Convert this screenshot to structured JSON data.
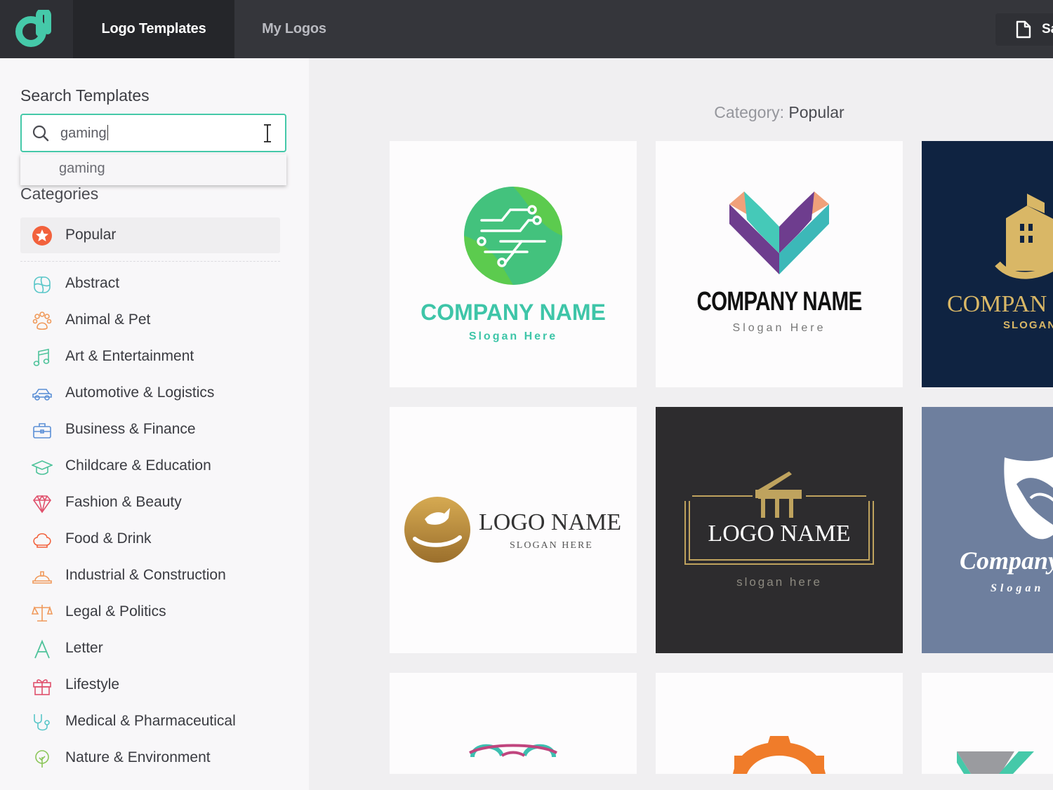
{
  "topbar": {
    "brand_icon": "d-logo-icon",
    "tabs": [
      "Logo Templates",
      "My Logos"
    ],
    "save": {
      "icon": "document-icon",
      "label": "Save"
    }
  },
  "sidebar": {
    "search_title": "Search Templates",
    "search_value": "gaming",
    "suggestion": "gaming",
    "categories_title": "Categories",
    "selected": "Popular",
    "categories": [
      "Abstract",
      "Animal & Pet",
      "Art & Entertainment",
      "Automotive & Logistics",
      "Business & Finance",
      "Childcare & Education",
      "Fashion & Beauty",
      "Food & Drink",
      "Industrial & Construction",
      "Legal & Politics",
      "Letter",
      "Lifestyle",
      "Medical & Pharmaceutical",
      "Nature & Environment"
    ]
  },
  "main": {
    "category_key": "Category:",
    "category_value": "Popular",
    "cards": [
      {
        "name": "COMPANY NAME",
        "slogan": "Slogan Here"
      },
      {
        "name": "COMPANY NAME",
        "slogan": "Slogan Here"
      },
      {
        "name": "COMPAN",
        "slogan": "SLOGAN"
      },
      {
        "name": "LOGO NAME",
        "slogan": "SLOGAN HERE"
      },
      {
        "name": "LOGO NAME",
        "slogan": "slogan here"
      },
      {
        "name": "Company",
        "slogan": "Slogan"
      }
    ]
  },
  "colors": {
    "accent": "#45c9a9",
    "topbar": "#35363b",
    "active_tab": "#25262a",
    "popular_star": "#f2613c"
  }
}
